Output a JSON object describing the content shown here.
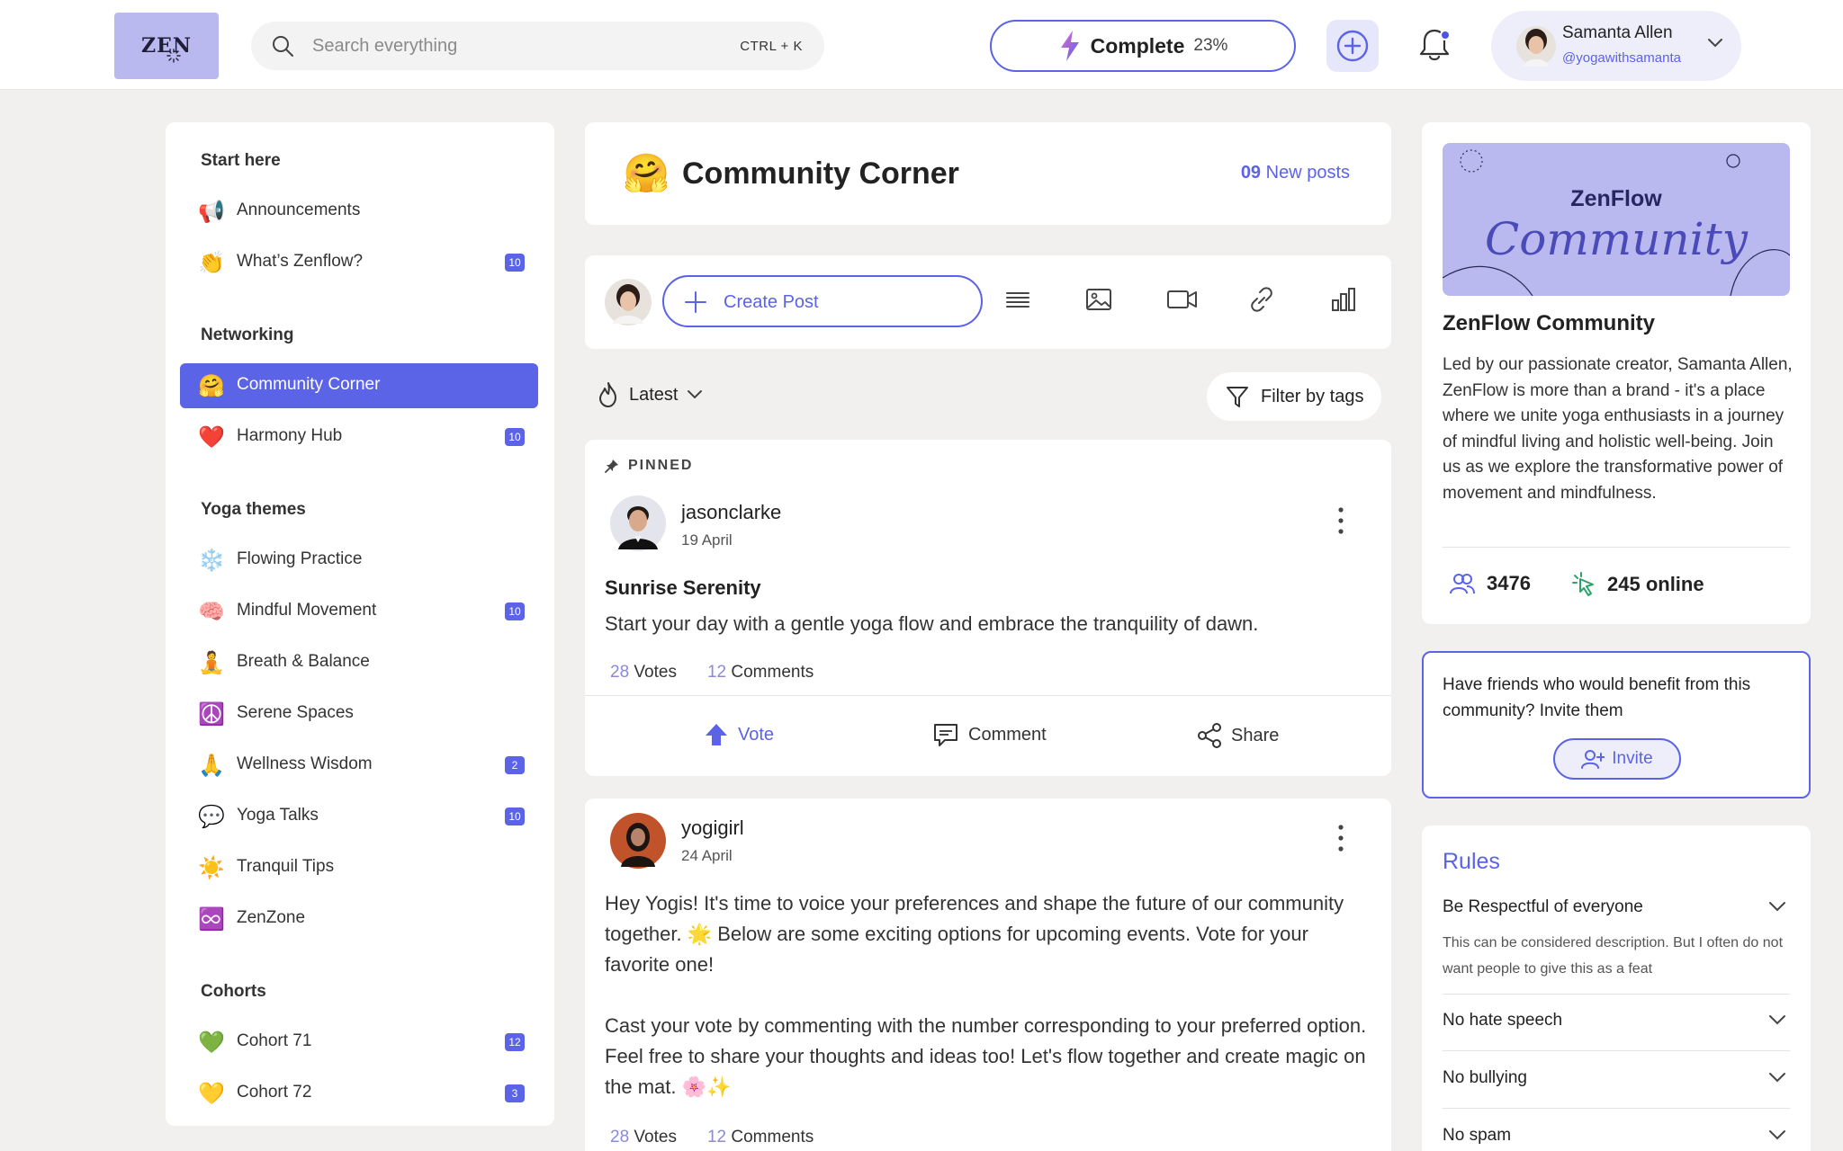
{
  "header": {
    "logo_text": "ZEN",
    "search_placeholder": "Search everything",
    "search_shortcut": "CTRL + K",
    "complete_label": "Complete",
    "complete_percent": "23%",
    "user": {
      "name": "Samanta Allen",
      "handle": "@yogawithsamanta"
    }
  },
  "sidebar": {
    "sections": [
      {
        "title": "Start here",
        "items": [
          {
            "emoji": "📢",
            "label": "Announcements",
            "badge": ""
          },
          {
            "emoji": "👏",
            "label": "What’s Zenflow?",
            "badge": "10"
          }
        ]
      },
      {
        "title": "Networking",
        "items": [
          {
            "emoji": "🤗",
            "label": "Community Corner",
            "badge": "",
            "active": true
          },
          {
            "emoji": "❤️",
            "label": "Harmony Hub",
            "badge": "10"
          }
        ]
      },
      {
        "title": "Yoga themes",
        "items": [
          {
            "emoji": "❄️",
            "label": "Flowing Practice",
            "badge": ""
          },
          {
            "emoji": "🧠",
            "label": "Mindful Movement",
            "badge": "10"
          },
          {
            "emoji": "🧘",
            "label": "Breath & Balance",
            "badge": ""
          },
          {
            "emoji": "☮️",
            "label": "Serene Spaces",
            "badge": ""
          },
          {
            "emoji": "🙏",
            "label": "Wellness Wisdom",
            "badge": "2"
          },
          {
            "emoji": "💬",
            "label": "Yoga Talks",
            "badge": "10"
          },
          {
            "emoji": "☀️",
            "label": "Tranquil Tips",
            "badge": ""
          },
          {
            "emoji": "♾️",
            "label": "ZenZone",
            "badge": ""
          }
        ]
      },
      {
        "title": "Cohorts",
        "items": [
          {
            "emoji": "💚",
            "label": "Cohort 71",
            "badge": "12"
          },
          {
            "emoji": "💛",
            "label": "Cohort 72",
            "badge": "3"
          }
        ]
      }
    ]
  },
  "main": {
    "channel_emoji": "🤗",
    "channel_title": "Community Corner",
    "new_posts_count": "09",
    "new_posts_label": "New posts",
    "create_post_label": "Create Post",
    "toolbar_icons": [
      "text-icon",
      "image-icon",
      "video-icon",
      "link-icon",
      "poll-icon"
    ],
    "sort_label": "Latest",
    "filter_label": "Filter by tags",
    "posts": [
      {
        "pinned_label": "PINNED",
        "author": "jasonclarke",
        "date": "19 April",
        "title": "Sunrise Serenity",
        "body": "Start your day with a gentle yoga flow and embrace the tranquility of dawn.",
        "votes": "28",
        "votes_label": "Votes",
        "comments": "12",
        "comments_label": "Comments",
        "actions": {
          "vote": "Vote",
          "comment": "Comment",
          "share": "Share"
        }
      },
      {
        "author": "yogigirl",
        "date": "24 April",
        "body_p1": "Hey Yogis! It's time to voice your preferences and shape the future of our community together. 🌟 Below are some exciting options for upcoming events. Vote for your favorite one!",
        "body_p2": "Cast your vote by commenting with the number corresponding to your preferred option. Feel free to share your thoughts and ideas too! Let's flow together and create magic on the mat. 🌸✨",
        "votes": "28",
        "votes_label": "Votes",
        "comments": "12",
        "comments_label": "Comments"
      }
    ]
  },
  "about": {
    "banner_line1": "ZenFlow",
    "banner_line2": "Community",
    "title": "ZenFlow Community",
    "description": "Led by our passionate creator, Samanta Allen, ZenFlow is more than a brand - it's a place where we unite yoga enthusiasts in a journey of mindful living and holistic well-being. Join us as we explore the transformative power of movement and mindfulness.",
    "members": "3476",
    "online": "245 online"
  },
  "invite": {
    "text": "Have friends who would benefit from this community? Invite them",
    "button": "Invite"
  },
  "rules": {
    "title": "Rules",
    "items": [
      {
        "label": "Be Respectful of everyone",
        "desc": "This can be considered description. But I often do not want people to give this as a feat"
      },
      {
        "label": "No hate speech"
      },
      {
        "label": "No bullying"
      },
      {
        "label": "No spam"
      }
    ]
  },
  "colors": {
    "accent": "#5b63e6",
    "accent_soft": "#b9b9f0",
    "background": "#f1f0ef"
  }
}
